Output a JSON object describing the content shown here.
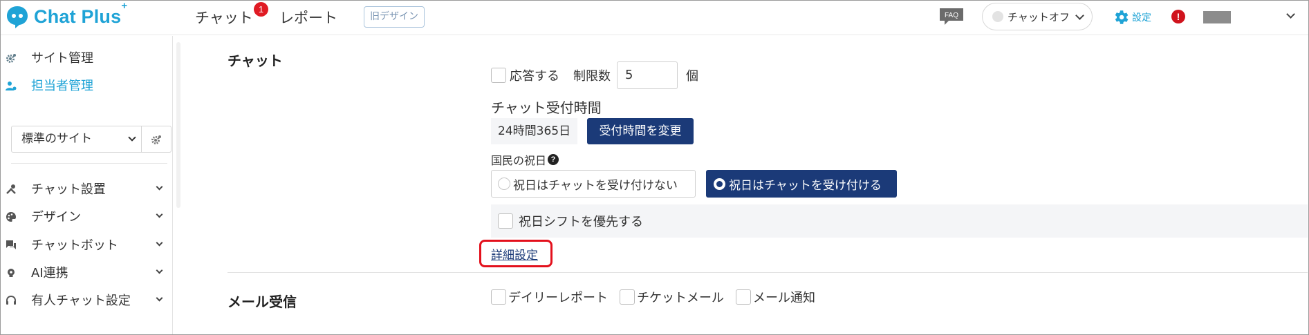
{
  "header": {
    "logo_text": "Chat Plus",
    "logo_plus": "+",
    "nav": [
      {
        "label": "チャット",
        "badge": "1"
      },
      {
        "label": "レポート"
      }
    ],
    "old_design_label": "旧デザイン",
    "faq_label": "FAQ",
    "chat_status": "チャットオフ",
    "settings_label": "設定",
    "alert_label": "!"
  },
  "sidebar": {
    "items": [
      {
        "label": "サイト管理",
        "icon": "gear-cog-icon"
      },
      {
        "label": "担当者管理",
        "icon": "user-gear-icon",
        "active": true
      }
    ],
    "site_select": "標準のサイト",
    "menu": [
      {
        "label": "チャット設置",
        "icon": "tools-icon"
      },
      {
        "label": "デザイン",
        "icon": "palette-icon"
      },
      {
        "label": "チャットボット",
        "icon": "chat-bubble-icon"
      },
      {
        "label": "AI連携",
        "icon": "lightbulb-icon"
      },
      {
        "label": "有人チャット設定",
        "icon": "headset-icon"
      }
    ]
  },
  "main": {
    "chat_section": {
      "title": "チャット",
      "respond_label": "応答する",
      "limit_label": "制限数",
      "limit_value": "5",
      "limit_unit": "個",
      "hours_title": "チャット受付時間",
      "hours_value": "24時間365日",
      "change_hours_button": "受付時間を変更",
      "holiday_label": "国民の祝日",
      "holiday_off_option": "祝日はチャットを受け付けない",
      "holiday_on_option": "祝日はチャットを受け付ける",
      "shift_priority_label": "祝日シフトを優先する",
      "detail_link": "詳細設定"
    },
    "mail_section": {
      "title": "メール受信",
      "options": [
        "デイリーレポート",
        "チケットメール",
        "メール通知"
      ]
    }
  },
  "colors": {
    "brand": "#1fa3d6",
    "navy": "#1b3a78",
    "badge": "#e01b24",
    "highlight": "#e3101c"
  }
}
